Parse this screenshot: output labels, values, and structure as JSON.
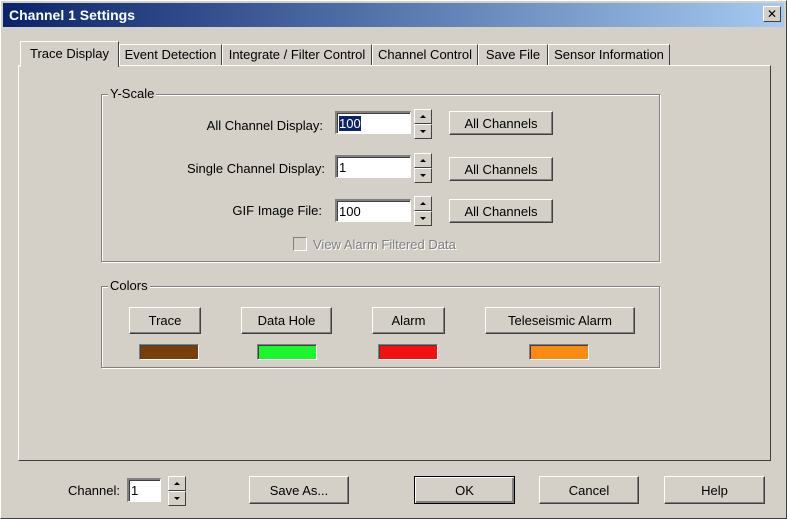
{
  "window": {
    "title": "Channel 1 Settings",
    "close_glyph": "✕"
  },
  "tabs": [
    {
      "label": "Trace Display",
      "active": true
    },
    {
      "label": "Event Detection"
    },
    {
      "label": "Integrate / Filter Control"
    },
    {
      "label": "Channel Control"
    },
    {
      "label": "Save File"
    },
    {
      "label": "Sensor Information"
    }
  ],
  "yscale": {
    "title": "Y-Scale",
    "rows": [
      {
        "label": "All Channel Display:",
        "value": "100",
        "button": "All Channels"
      },
      {
        "label": "Single Channel Display:",
        "value": "1",
        "button": "All Channels"
      },
      {
        "label": "GIF Image File:",
        "value": "100",
        "button": "All Channels"
      }
    ],
    "checkbox_label": "View Alarm Filtered Data"
  },
  "colors": {
    "title": "Colors",
    "items": [
      {
        "label": "Trace",
        "color": "#7a3e0a"
      },
      {
        "label": "Data Hole",
        "color": "#1cf62c"
      },
      {
        "label": "Alarm",
        "color": "#f41010"
      },
      {
        "label": "Teleseismic  Alarm",
        "color": "#f98a12"
      }
    ]
  },
  "footer": {
    "channel_label": "Channel:",
    "channel_value": "1",
    "save_as": "Save As...",
    "ok": "OK",
    "cancel": "Cancel",
    "help": "Help"
  }
}
